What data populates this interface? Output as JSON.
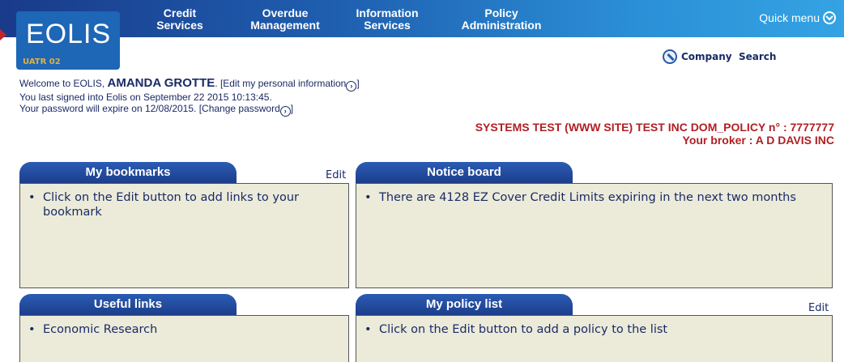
{
  "nav": {
    "items": [
      {
        "line1": "Credit",
        "line2": "Services"
      },
      {
        "line1": "Overdue",
        "line2": "Management"
      },
      {
        "line1": "Information",
        "line2": "Services"
      },
      {
        "line1": "Policy",
        "line2": "Administration"
      }
    ],
    "quick_menu": "Quick menu"
  },
  "logo": {
    "text": "EOLIS",
    "subtext": "UATR 02"
  },
  "company_search": "Company  Search",
  "welcome": {
    "prefix": "Welcome to EOLIS, ",
    "user_name": "AMANDA GROTTE",
    "edit_personal": ". [Edit my personal information",
    "last_signed": "You last signed into Eolis on September 22 2015 10:13:45.",
    "password_prefix": "Your password will expire on 12/08/2015. [Change password",
    "close_bracket": "]"
  },
  "policy": {
    "line1": "SYSTEMS TEST (WWW SITE) TEST INC DOM_POLICY n° : 7777777",
    "line2": "Your broker : A D DAVIS INC"
  },
  "panels": {
    "bookmarks": {
      "title": "My bookmarks",
      "edit": "Edit",
      "items": [
        "Click on the Edit button to add links to your bookmark"
      ]
    },
    "notice": {
      "title": "Notice board",
      "items": [
        "There are 4128 EZ Cover Credit Limits expiring in the next two months"
      ]
    },
    "useful": {
      "title": "Useful links",
      "items": [
        "Economic Research"
      ]
    },
    "policies": {
      "title": "My policy list",
      "edit": "Edit",
      "items": [
        "Click on the Edit button to add a policy to the list"
      ]
    }
  },
  "colors": {
    "brand_blue": "#1e66b6",
    "policy_red": "#b01f24",
    "panel_bg": "#ecebd9"
  }
}
